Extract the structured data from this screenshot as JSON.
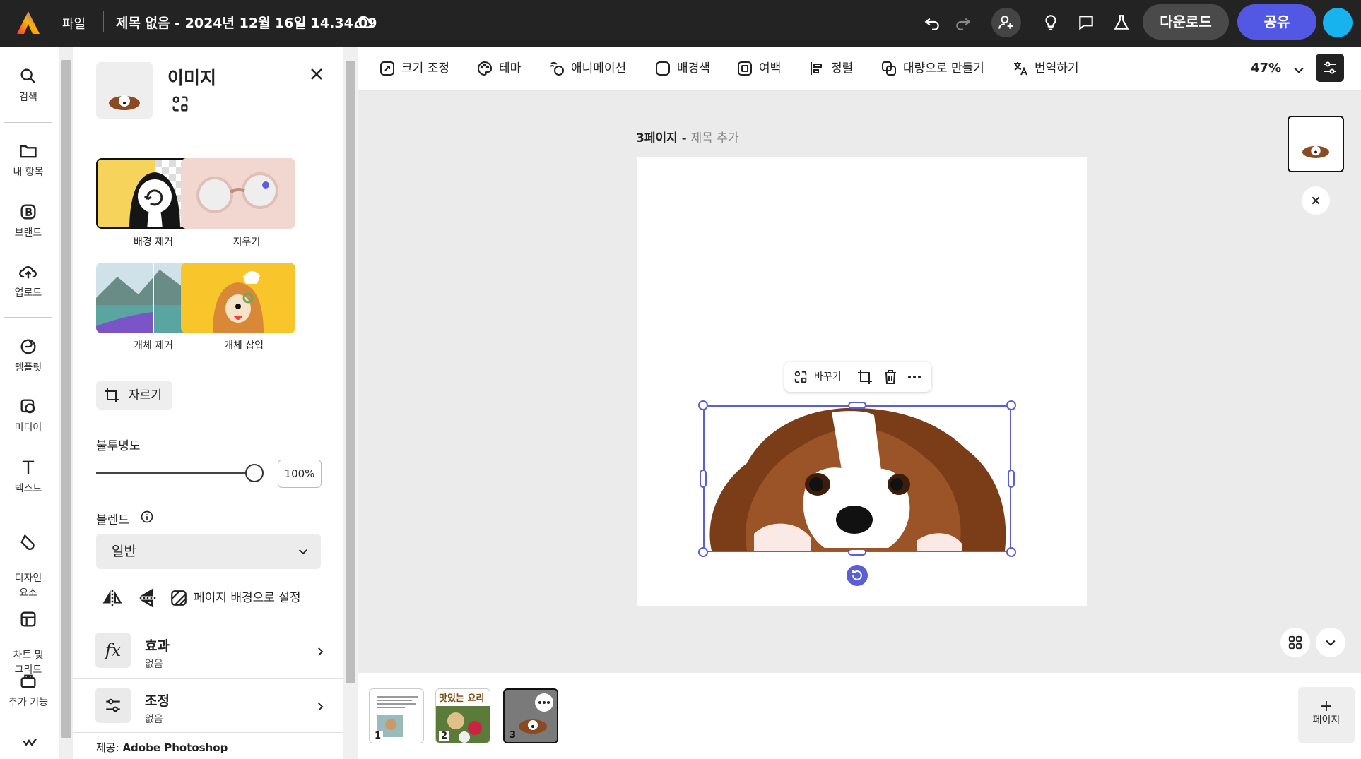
{
  "topbar": {
    "file_menu": "파일",
    "doc_title": "제목 없음 - 2024년 12월 16일 14.34.09",
    "download": "다운로드",
    "share": "공유"
  },
  "rail": {
    "items": [
      {
        "label": "검색",
        "icon": "search-icon"
      },
      {
        "label": "내 항목",
        "icon": "folder-icon"
      },
      {
        "label": "브랜드",
        "icon": "brand-icon"
      },
      {
        "label": "업로드",
        "icon": "upload-icon"
      },
      {
        "label": "템플릿",
        "icon": "template-icon"
      },
      {
        "label": "미디어",
        "icon": "media-icon"
      },
      {
        "label": "텍스트",
        "icon": "text-icon"
      },
      {
        "label": "디자인\n요소",
        "icon": "shapes-icon"
      },
      {
        "label": "차트 및\n그리드",
        "icon": "chart-grid-icon"
      },
      {
        "label": "추가 기능",
        "icon": "addons-icon"
      }
    ]
  },
  "panel": {
    "title": "이미지",
    "tools": [
      {
        "label": "배경 제거"
      },
      {
        "label": "지우기"
      },
      {
        "label": "개체 제거"
      },
      {
        "label": "개체 삽입"
      }
    ],
    "crop": "자르기",
    "opacity_label": "불투명도",
    "opacity_value": "100%",
    "opacity_fraction": 1.0,
    "blend_label": "블렌드",
    "blend_value": "일반",
    "set_bg": "페이지 배경으로 설정",
    "effects_title": "효과",
    "effects_sub": "없음",
    "adjust_title": "조정",
    "adjust_sub": "없음",
    "provider_prefix": "제공:",
    "provider_name": "Adobe Photoshop"
  },
  "toolbar": {
    "tools": [
      "크기 조정",
      "테마",
      "애니메이션",
      "배경색",
      "여백",
      "정렬",
      "대량으로 만들기",
      "번역하기"
    ],
    "zoom": "47%"
  },
  "canvas": {
    "page_label_bold": "3페이지 - ",
    "page_label_placeholder": "제목 추가",
    "ctx_replace": "바꾸기"
  },
  "strip": {
    "pages": [
      {
        "num": "1",
        "thumb_text": ""
      },
      {
        "num": "2",
        "thumb_text": "맛있는 요리"
      },
      {
        "num": "3",
        "thumb_text": ""
      }
    ],
    "add_page": "페이지"
  },
  "colors": {
    "accent": "#5258e4",
    "selection": "#5b5fd6",
    "topbar_bg": "#232323"
  }
}
